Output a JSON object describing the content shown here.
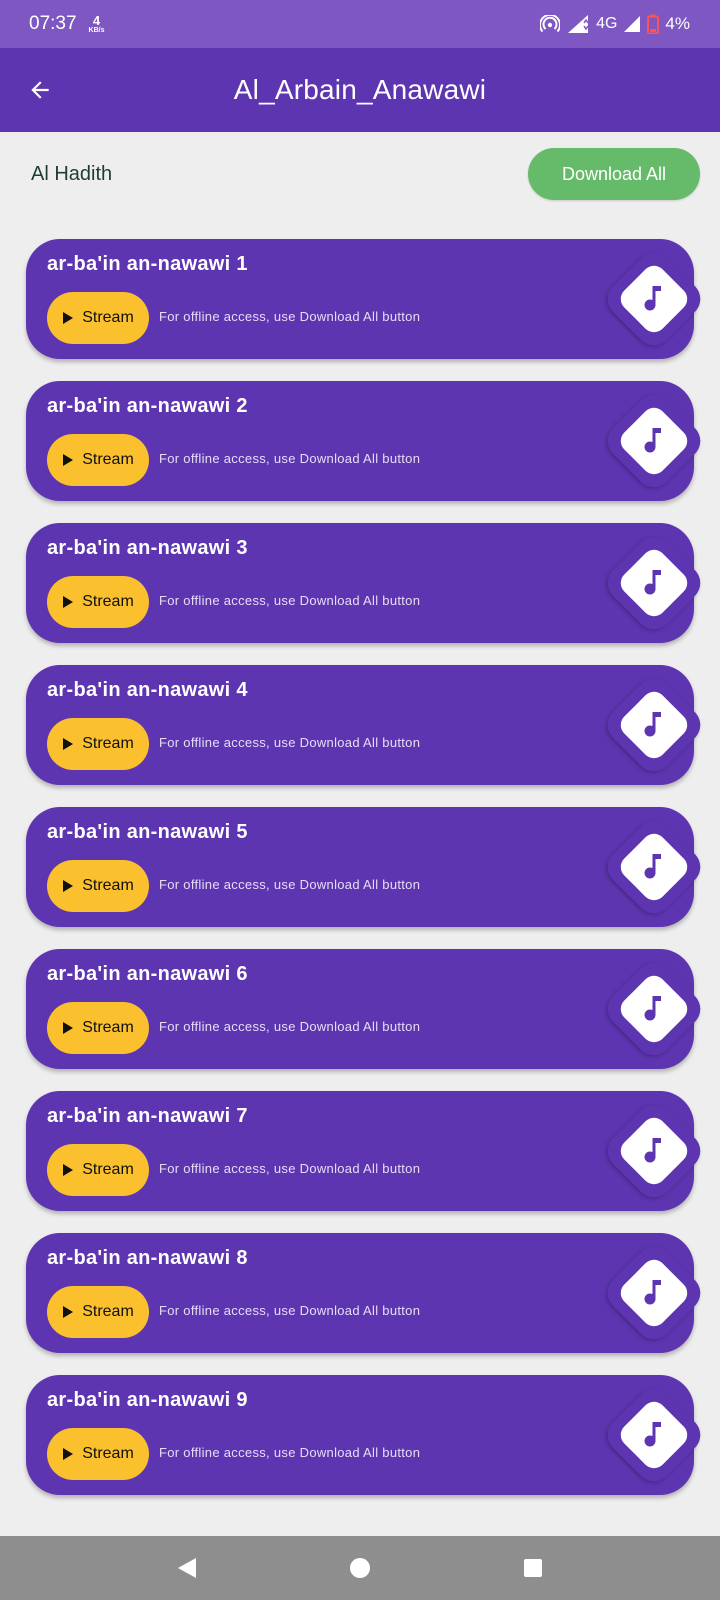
{
  "status_bar": {
    "time": "07:37",
    "net_speed_value": "4",
    "net_speed_unit": "KB/s",
    "network_type": "4G",
    "battery": "4%",
    "icons": [
      "hotspot-icon",
      "signal-icon",
      "signal-icon",
      "battery-low-icon"
    ]
  },
  "app_bar": {
    "title": "Al_Arbain_Anawawi",
    "back_icon": "arrow-left-icon"
  },
  "section": {
    "label": "Al Hadith",
    "download_all_label": "Download All"
  },
  "tracks": [
    {
      "title": "ar-ba'in an-nawawi 1",
      "stream_label": "Stream",
      "note": "For offline access, use Download All button"
    },
    {
      "title": "ar-ba'in an-nawawi 2",
      "stream_label": "Stream",
      "note": "For offline access, use Download All button"
    },
    {
      "title": "ar-ba'in an-nawawi 3",
      "stream_label": "Stream",
      "note": "For offline access, use Download All button"
    },
    {
      "title": "ar-ba'in an-nawawi 4",
      "stream_label": "Stream",
      "note": "For offline access, use Download All button"
    },
    {
      "title": "ar-ba'in an-nawawi 5",
      "stream_label": "Stream",
      "note": "For offline access, use Download All button"
    },
    {
      "title": "ar-ba'in an-nawawi 6",
      "stream_label": "Stream",
      "note": "For offline access, use Download All button"
    },
    {
      "title": "ar-ba'in an-nawawi 7",
      "stream_label": "Stream",
      "note": "For offline access, use Download All button"
    },
    {
      "title": "ar-ba'in an-nawawi 8",
      "stream_label": "Stream",
      "note": "For offline access, use Download All button"
    },
    {
      "title": "ar-ba'in an-nawawi 9",
      "stream_label": "Stream",
      "note": "For offline access, use Download All button"
    }
  ],
  "colors": {
    "status_bar": "#7e57c2",
    "primary": "#5e35b1",
    "stream_button": "#fbc02d",
    "download_button": "#66bb6a",
    "background": "#eeeeee",
    "nav_bar": "#8e8e8e"
  },
  "nav_bar": {
    "icons": [
      "back-triangle-icon",
      "home-circle-icon",
      "recents-square-icon"
    ]
  }
}
